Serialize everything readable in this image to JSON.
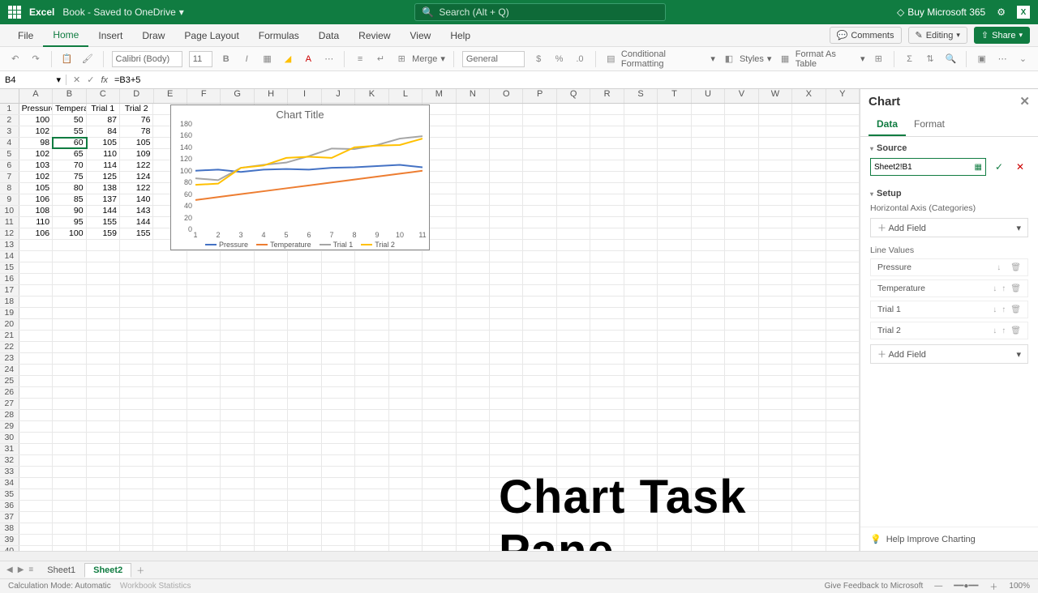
{
  "titlebar": {
    "app": "Excel",
    "doc": "Book - Saved to OneDrive",
    "search_placeholder": "Search (Alt + Q)",
    "buy": "Buy Microsoft 365"
  },
  "tabs": [
    "File",
    "Home",
    "Insert",
    "Draw",
    "Page Layout",
    "Formulas",
    "Data",
    "Review",
    "View",
    "Help"
  ],
  "active_tab": "Home",
  "ribbon_actions": {
    "comments": "Comments",
    "editing": "Editing",
    "share": "Share"
  },
  "toolbar": {
    "font": "Calibri (Body)",
    "size": "11",
    "merge": "Merge",
    "numfmt": "General",
    "cond": "Conditional Formatting",
    "styles": "Styles",
    "fmt_table": "Format As Table"
  },
  "formula_bar": {
    "name_box": "B4",
    "formula": "=B3+5"
  },
  "columns": [
    "A",
    "B",
    "C",
    "D",
    "E",
    "F",
    "G",
    "H",
    "I",
    "J",
    "K",
    "L",
    "M",
    "N",
    "O",
    "P",
    "Q",
    "R",
    "S",
    "T",
    "U",
    "V",
    "W",
    "X",
    "Y"
  ],
  "headers": [
    "Pressure",
    "Temperature",
    "Trial 1",
    "Trial 2"
  ],
  "chart_data": {
    "type": "line",
    "title": "Chart Title",
    "x": [
      1,
      2,
      3,
      4,
      5,
      6,
      7,
      8,
      9,
      10,
      11
    ],
    "ylim": [
      0,
      180
    ],
    "yticks": [
      0,
      20,
      40,
      60,
      80,
      100,
      120,
      140,
      160,
      180
    ],
    "series": [
      {
        "name": "Pressure",
        "color": "#4472c4",
        "values": [
          100,
          102,
          98,
          102,
          103,
          102,
          105,
          106,
          108,
          110,
          106
        ]
      },
      {
        "name": "Temperature",
        "color": "#ed7d31",
        "values": [
          50,
          55,
          60,
          65,
          70,
          75,
          80,
          85,
          90,
          95,
          100
        ]
      },
      {
        "name": "Trial 1",
        "color": "#a5a5a5",
        "values": [
          87,
          84,
          105,
          110,
          114,
          125,
          138,
          137,
          144,
          155,
          159
        ]
      },
      {
        "name": "Trial 2",
        "color": "#ffc000",
        "values": [
          76,
          78,
          105,
          109,
          122,
          124,
          122,
          140,
          143,
          144,
          155
        ]
      }
    ]
  },
  "row_count": 42,
  "selected_cell": {
    "row": 4,
    "col": 1
  },
  "watermark": "Chart Task Pane",
  "taskpane": {
    "title": "Chart",
    "tabs": [
      "Data",
      "Format"
    ],
    "active": "Data",
    "source_label": "Source",
    "source_value": "Sheet2!B1",
    "setup_label": "Setup",
    "horiz_label": "Horizontal Axis (Categories)",
    "add_field": "Add Field",
    "line_values": "Line Values",
    "series": [
      "Pressure",
      "Temperature",
      "Trial 1",
      "Trial 2"
    ],
    "help": "Help Improve Charting"
  },
  "sheets": {
    "list": [
      "Sheet1",
      "Sheet2"
    ],
    "active": "Sheet2"
  },
  "status": {
    "calc": "Calculation Mode: Automatic",
    "stats": "Workbook Statistics",
    "feedback": "Give Feedback to Microsoft",
    "zoom": "100%"
  }
}
